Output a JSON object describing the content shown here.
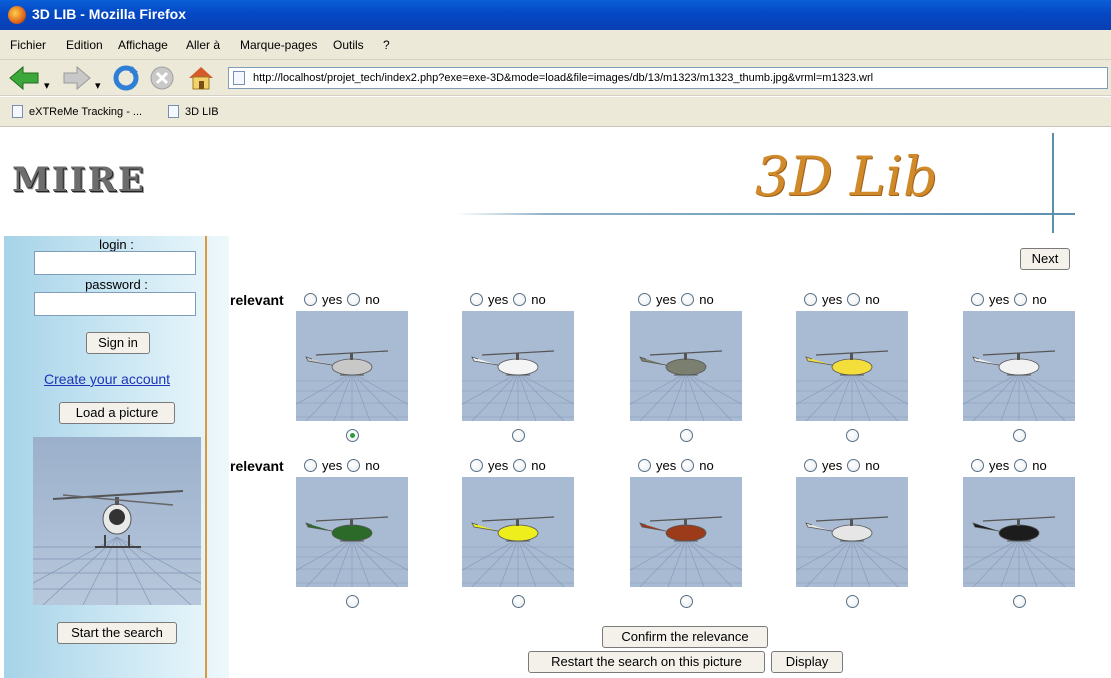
{
  "window": {
    "title": "3D LIB - Mozilla Firefox"
  },
  "menu": {
    "items": [
      "Fichier",
      "Edition",
      "Affichage",
      "Aller à",
      "Marque-pages",
      "Outils",
      "?"
    ]
  },
  "toolbar": {
    "back": "back-icon",
    "forward": "forward-icon",
    "reload": "reload-icon",
    "stop": "stop-icon",
    "home": "home-icon"
  },
  "address": {
    "url": "http://localhost/projet_tech/index2.php?exe=exe-3D&mode=load&file=images/db/13/m1323/m1323_thumb.jpg&vrml=m1323.wrl"
  },
  "bookmarks": [
    "eXTReMe Tracking - ...",
    "3D LIB"
  ],
  "header": {
    "logo": "MIIRE",
    "title": "3D Lib"
  },
  "sidebar": {
    "login_label": "login :",
    "password_label": "password :",
    "sign_in": "Sign in",
    "create_account": "Create your account",
    "load_picture": "Load a picture",
    "start_search": "Start the search"
  },
  "results": {
    "next": "Next",
    "relevant_label": "relevant",
    "yes": "yes",
    "no": "no",
    "selected_index": 0,
    "thumbnails": [
      {
        "color": "#c8c8c8"
      },
      {
        "color": "#f4f4f4"
      },
      {
        "color": "#7b7f6f"
      },
      {
        "color": "#f3de3b"
      },
      {
        "color": "#f2f2f2"
      },
      {
        "color": "#2c6a2a"
      },
      {
        "color": "#eeee1c"
      },
      {
        "color": "#9c3b1a"
      },
      {
        "color": "#e6e6e6"
      },
      {
        "color": "#1c1c1c"
      }
    ]
  },
  "actions": {
    "confirm": "Confirm the relevance",
    "restart": "Restart the search on this picture",
    "display": "Display"
  }
}
